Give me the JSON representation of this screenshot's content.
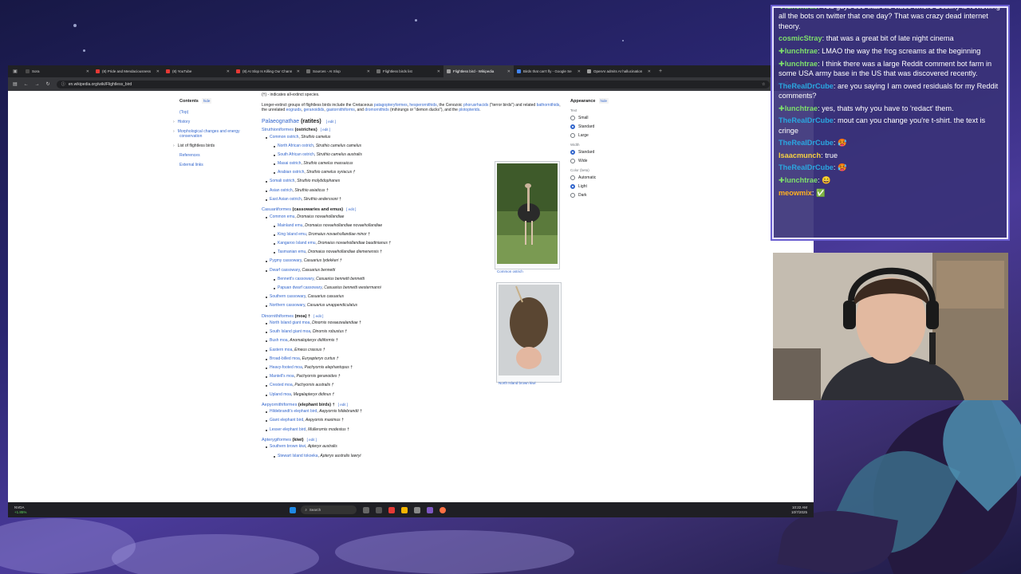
{
  "browser": {
    "tabs": [
      {
        "label": "Sora",
        "color": "#4a4a4a",
        "active": false
      },
      {
        "label": "(8) Pride and Mendaciousness",
        "color": "#e53935",
        "active": false
      },
      {
        "label": "(8) YouTube",
        "color": "#e53935",
        "active": false
      },
      {
        "label": "(8) AI Slop Is Killing Our Chann",
        "color": "#e53935",
        "active": false
      },
      {
        "label": "Sources - AI Slop",
        "color": "#6d6d6d",
        "active": false
      },
      {
        "label": "Flightless birds list",
        "color": "#6d6d6d",
        "active": false
      },
      {
        "label": "Flightless bird - Wikipedia",
        "color": "#9e9e9e",
        "active": true
      },
      {
        "label": "Birds that can't fly - Google Se",
        "color": "#4285f4",
        "active": false
      },
      {
        "label": "OpenAI admits AI hallucination",
        "color": "#9e9e9e",
        "active": false
      }
    ],
    "url": "en.wikipedia.org/wiki/Flightless_bird",
    "status_link": "en.wikipedia.org/wiki/Struthioniformes"
  },
  "contents": {
    "title": "Contents",
    "hide": "hide",
    "items": [
      "(Top)",
      "History",
      "Morphological changes and energy conservation",
      "List of flightless birds",
      "References",
      "External links"
    ]
  },
  "article": {
    "top_note": "(†) - indicates all-extinct species.",
    "intro_parts": [
      "Longer-extinct groups of flightless birds include the Cretaceous ",
      "patagopteryformes",
      ", ",
      "hesperornithids",
      ", the Cenozoic ",
      "phorusrhacids",
      " (\"terror birds\") and related ",
      "bathornithids",
      ", the unrelated ",
      "eogruids",
      ", ",
      "geranoidids",
      ", ",
      "gastornithiforms",
      ", and ",
      "dromornithids",
      " (mihirungs or \"demon ducks\"), and the ",
      "plotopterids",
      "."
    ],
    "edit": "edit",
    "sections": [
      {
        "title": "Palaeognathae",
        "suffix": "(ratites)"
      }
    ],
    "groups": [
      {
        "name": "Struthioniformes",
        "suffix": "(ostriches)",
        "rows": [
          {
            "c": "Common ostrich",
            "s": "Struthio camelus",
            "sub": false
          },
          {
            "c": "North African ostrich",
            "s": "Struthio camelus camelus",
            "sub": true
          },
          {
            "c": "South African ostrich",
            "s": "Struthio camelus australis",
            "sub": true
          },
          {
            "c": "Masai ostrich",
            "s": "Struthio camelus massaicus",
            "sub": true
          },
          {
            "c": "Arabian ostrich",
            "s": "Struthio camelus syriacus †",
            "sub": true
          },
          {
            "c": "Somali ostrich",
            "s": "Struthio molybdophanes",
            "sub": false
          },
          {
            "c": "Asian ostrich",
            "s": "Struthio asiaticus †",
            "sub": false
          },
          {
            "c": "East Asian ostrich",
            "s": "Struthio anderssoni †",
            "sub": false
          }
        ]
      },
      {
        "name": "Casuariiformes",
        "suffix": "(cassowaries and emus)",
        "rows": [
          {
            "c": "Common emu",
            "s": "Dromaius novaehollandiae",
            "sub": false
          },
          {
            "c": "Mainland emu",
            "s": "Dromaius novaehollandiae novaehollandiae",
            "sub": true
          },
          {
            "c": "King Island emu",
            "s": "Dromaius novaehollandiae minor †",
            "sub": true
          },
          {
            "c": "Kangaroo Island emu",
            "s": "Dromaius novaehollandiae baudinianus †",
            "sub": true
          },
          {
            "c": "Tasmanian emu",
            "s": "Dromaius novaehollandiae diemenensis †",
            "sub": true
          },
          {
            "c": "Pygmy cassowary",
            "s": "Casuarius lydekkeri †",
            "sub": false
          },
          {
            "c": "Dwarf cassowary",
            "s": "Casuarius bennetti",
            "sub": false
          },
          {
            "c": "Bennett's cassowary",
            "s": "Casuarius bennetti bennetti",
            "sub": true
          },
          {
            "c": "Papuan dwarf cassowary",
            "s": "Casuarius bennetti westermanni",
            "sub": true
          },
          {
            "c": "Southern cassowary",
            "s": "Casuarius casuarius",
            "sub": false
          },
          {
            "c": "Northern cassowary",
            "s": "Casuarius unappendiculatus",
            "sub": false
          }
        ]
      },
      {
        "name": "Dinornithiformes",
        "suffix": "(moa) †",
        "rows": [
          {
            "c": "North Island giant moa",
            "s": "Dinornis novaezealandiae †",
            "sub": false
          },
          {
            "c": "South Island giant moa",
            "s": "Dinornis robustus †",
            "sub": false
          },
          {
            "c": "Bush moa",
            "s": "Anomalopteryx didiformis †",
            "sub": false
          },
          {
            "c": "Eastern moa",
            "s": "Emeus crassus †",
            "sub": false
          },
          {
            "c": "Broad-billed moa",
            "s": "Euryapteryx curtus †",
            "sub": false
          },
          {
            "c": "Heavy-footed moa",
            "s": "Pachyornis elephantopus †",
            "sub": false
          },
          {
            "c": "Mantell's moa",
            "s": "Pachyornis geranoides †",
            "sub": false
          },
          {
            "c": "Crested moa",
            "s": "Pachyornis australis †",
            "sub": false
          },
          {
            "c": "Upland moa",
            "s": "Megalapteryx didinus †",
            "sub": false
          }
        ]
      },
      {
        "name": "Aepyornithiformes",
        "suffix": "(elephant birds) †",
        "rows": [
          {
            "c": "Hildebrandt's elephant bird",
            "s": "Aepyornis hildebrandti †",
            "sub": false
          },
          {
            "c": "Giant elephant bird",
            "s": "Aepyornis maximus †",
            "sub": false
          },
          {
            "c": "Lesser elephant bird",
            "s": "Mullerornis modestus †",
            "sub": false
          }
        ]
      },
      {
        "name": "Apterygiformes",
        "suffix": "(kiwi)",
        "rows": [
          {
            "c": "Southern brown kiwi",
            "s": "Apteryx australis",
            "sub": false
          },
          {
            "c": "Stewart Island tokoeka",
            "s": "Apteryx australis lawryi",
            "sub": true
          }
        ]
      }
    ],
    "figures": [
      {
        "caption": "Common ostrich"
      },
      {
        "caption": "North Island brown kiwi"
      }
    ]
  },
  "appearance": {
    "title": "Appearance",
    "hide": "hide",
    "text_label": "Text",
    "text_options": [
      "Small",
      "Standard",
      "Large"
    ],
    "width_label": "Width",
    "width_options": [
      "Standard",
      "Wide"
    ],
    "color_label": "Color (beta)",
    "color_options": [
      "Automatic",
      "Light",
      "Dark"
    ]
  },
  "taskbar": {
    "stock_name": "NVDA",
    "stock_change": "+1.85%",
    "search_placeholder": "Search",
    "time": "10:22 AM",
    "date": "10/7/2025"
  },
  "chat": [
    {
      "user": "lunchtrae",
      "color": "#7ee06a",
      "badge": true,
      "text": "You guys see that the video where Destiny is reviewing all the bots on twitter that one day? That was crazy dead internet theory."
    },
    {
      "user": "cosmicStray",
      "color": "#7ee06a",
      "badge": false,
      "text": "that was a great bit of late night cinema"
    },
    {
      "user": "lunchtrae",
      "color": "#7ee06a",
      "badge": true,
      "text": "LMAO the way the frog screams at the beginning"
    },
    {
      "user": "lunchtrae",
      "color": "#7ee06a",
      "badge": true,
      "text": "I think there was a large Reddit comment bot farm in some USA army base in the US that was discovered recently."
    },
    {
      "user": "TheRealDrCube",
      "color": "#2aa7e0",
      "badge": false,
      "text": "are you saying I am owed residuals for my Reddit comments?"
    },
    {
      "user": "lunchtrae",
      "color": "#7ee06a",
      "badge": true,
      "text": "yes, thats why you have to 'redact' them."
    },
    {
      "user": "TheRealDrCube",
      "color": "#2aa7e0",
      "badge": false,
      "text": "mout can you change you're t-shirt. the text is cringe"
    },
    {
      "user": "TheRealDrCube",
      "color": "#2aa7e0",
      "badge": false,
      "text": "🥵"
    },
    {
      "user": "Isaacmunch",
      "color": "#f5d142",
      "badge": false,
      "text": "true"
    },
    {
      "user": "TheRealDrCube",
      "color": "#2aa7e0",
      "badge": false,
      "text": "🥵"
    },
    {
      "user": "lunchtrae",
      "color": "#7ee06a",
      "badge": true,
      "text": "😄"
    },
    {
      "user": "meowmix",
      "color": "#ffb020",
      "badge": false,
      "text": "✅"
    }
  ],
  "colors": {
    "link": "#3366cc",
    "chat_bg": "#3a3278",
    "browser_tab_bg": "#202124"
  }
}
